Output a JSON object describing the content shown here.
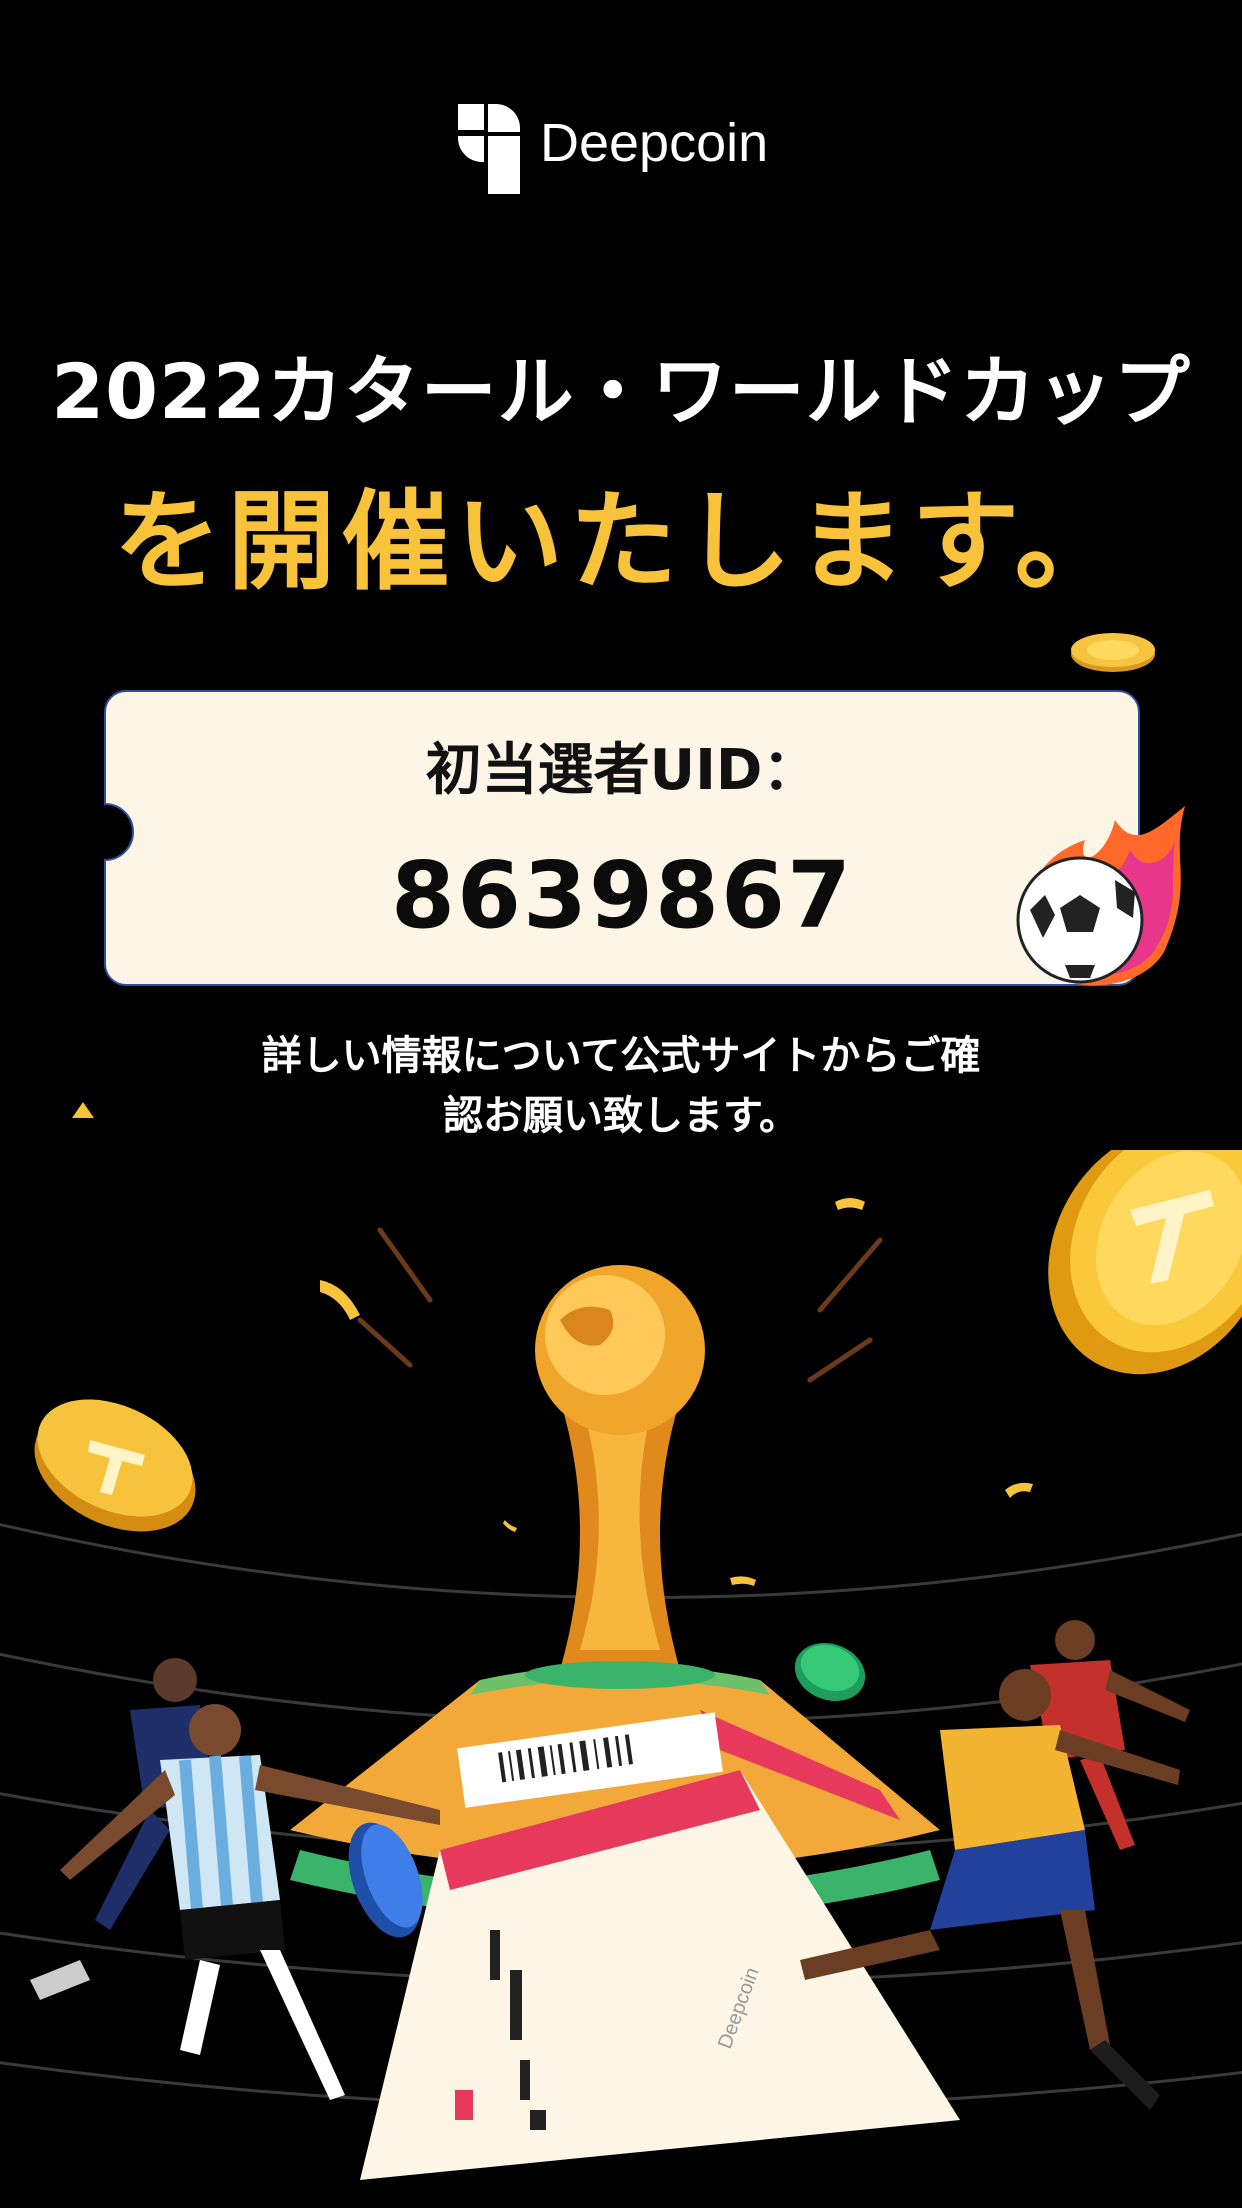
{
  "brand": {
    "name": "Deepcoin",
    "logo_icon": "deepcoin-logo-icon"
  },
  "headline": {
    "line1": "2022カタール・ワールドカップ",
    "line2": "を開催いたします。"
  },
  "ticket": {
    "label": "初当選者UID：",
    "uid": "8639867"
  },
  "info": {
    "line1": "詳しい情報について公式サイトからご確",
    "line2": "認お願い致します。"
  },
  "colors": {
    "accent_yellow": "#f8c33a",
    "ticket_bg": "#fdf6e6",
    "background": "#000000"
  },
  "illustration": {
    "icons": [
      "trophy-illustration",
      "flaming-soccer-ball-icon",
      "tether-coin-icon",
      "ticket-illustration",
      "player-illustration"
    ],
    "ticket_brand": "Deepcoin"
  }
}
